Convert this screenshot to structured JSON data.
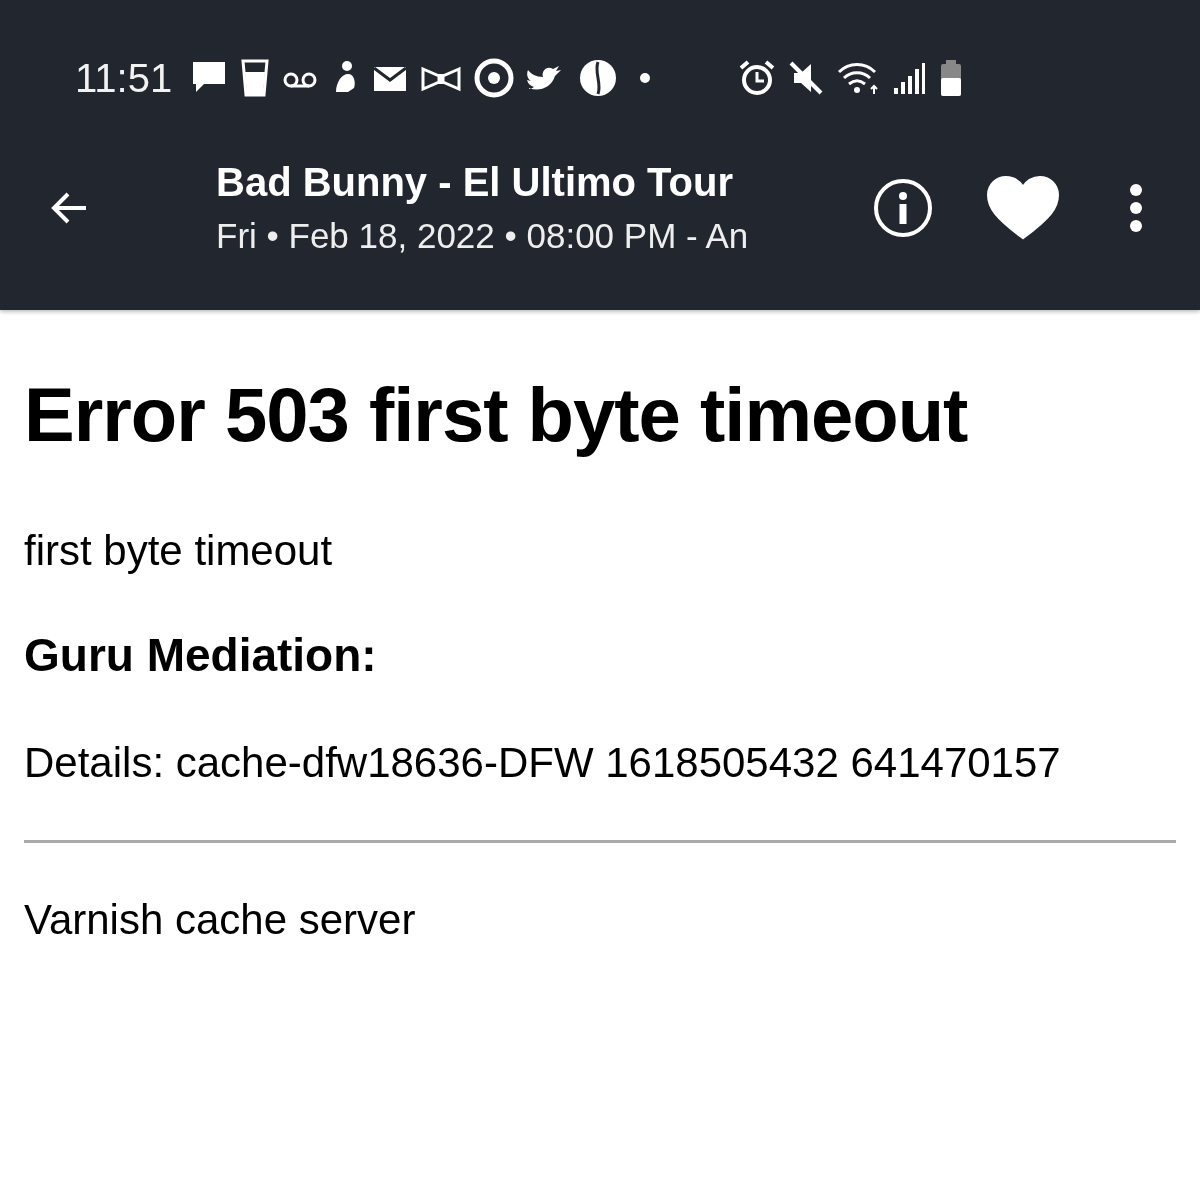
{
  "status_bar": {
    "time": "11:51"
  },
  "app_bar": {
    "title": "Bad Bunny - El Ultimo Tour",
    "subtitle": "Fri • Feb 18, 2022 • 08:00 PM - An",
    "favorite": true
  },
  "page": {
    "heading": "Error 503 first byte timeout",
    "message": "first byte timeout",
    "subheading": "Guru Mediation:",
    "details": "Details: cache-dfw18636-DFW 1618505432 641470157",
    "footer": "Varnish cache server"
  }
}
